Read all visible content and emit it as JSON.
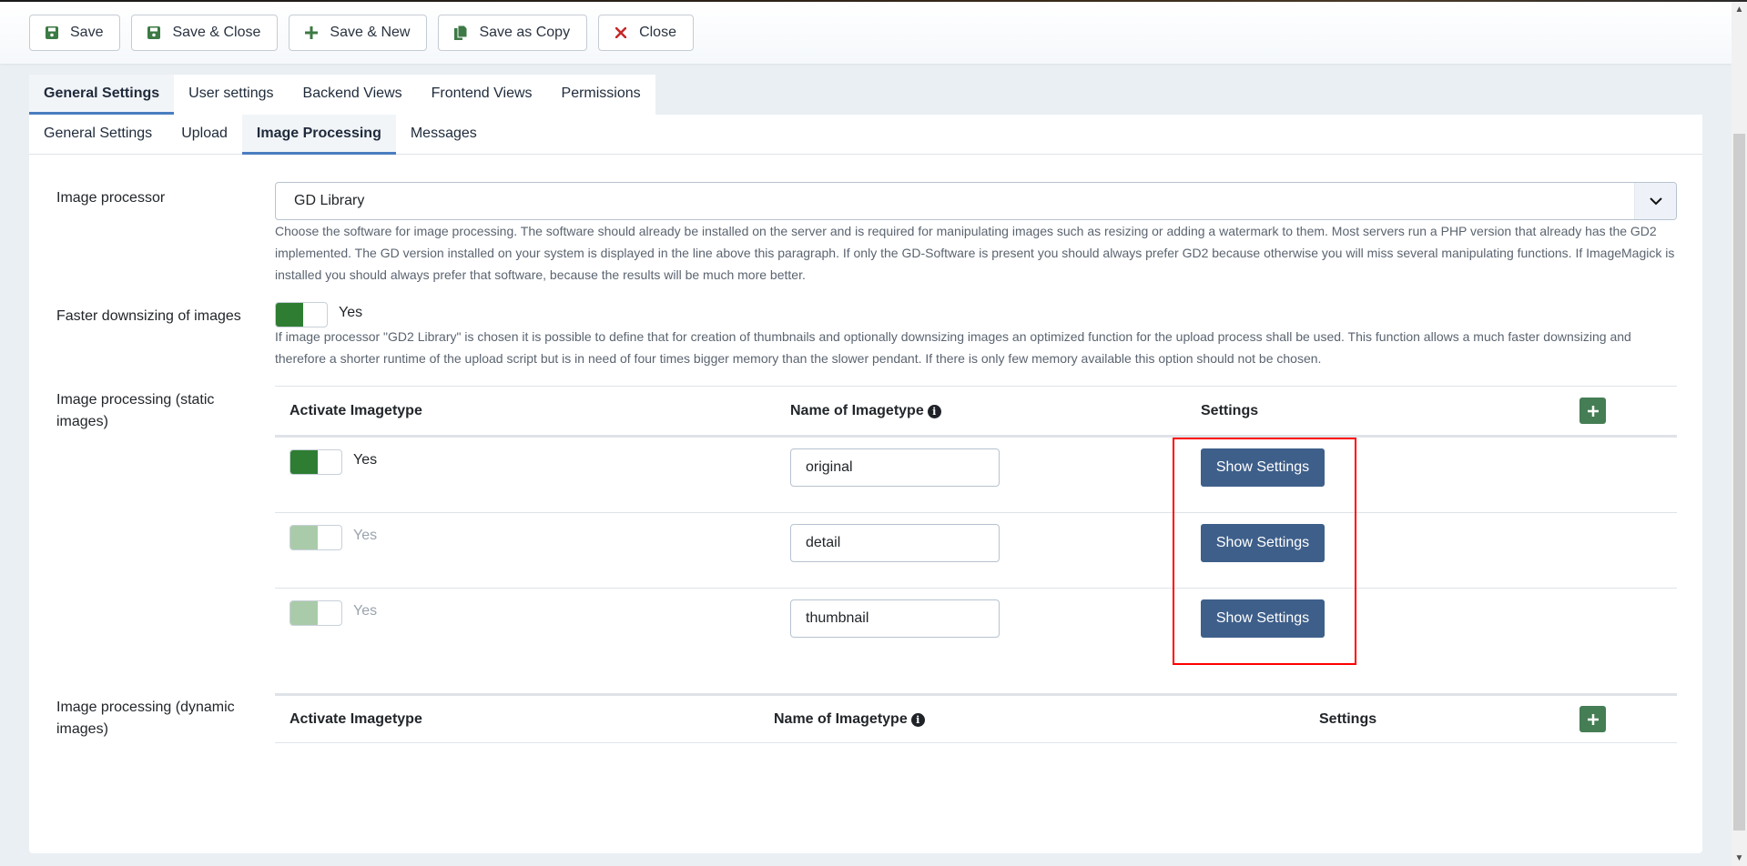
{
  "toolbar": {
    "buttons": [
      {
        "label": "Save",
        "icon": "save-icon"
      },
      {
        "label": "Save & Close",
        "icon": "save-icon"
      },
      {
        "label": "Save & New",
        "icon": "plus-icon"
      },
      {
        "label": "Save as Copy",
        "icon": "copy-icon"
      },
      {
        "label": "Close",
        "icon": "close-icon"
      }
    ]
  },
  "main_tabs": [
    {
      "label": "General Settings",
      "active": true
    },
    {
      "label": "User settings",
      "active": false
    },
    {
      "label": "Backend Views",
      "active": false
    },
    {
      "label": "Frontend Views",
      "active": false
    },
    {
      "label": "Permissions",
      "active": false
    }
  ],
  "sub_tabs": [
    {
      "label": "General Settings",
      "active": false
    },
    {
      "label": "Upload",
      "active": false
    },
    {
      "label": "Image Processing",
      "active": true
    },
    {
      "label": "Messages",
      "active": false
    }
  ],
  "fields": {
    "image_processor": {
      "label": "Image processor",
      "value": "GD Library",
      "description": "Choose the software for image processing. The software should already be installed on the server and is required for manipulating images such as resizing or adding a watermark to them. Most servers run a PHP version that already has the GD2 implemented. The GD version installed on your system is displayed in the line above this paragraph. If only the GD-Software is present you should always prefer GD2 because otherwise you will miss several manipulating functions. If ImageMagick is installed you should always prefer that software, because the results will be much more better."
    },
    "faster_downsizing": {
      "label": "Faster downsizing of images",
      "value": "Yes",
      "enabled": true,
      "description": "If image processor \"GD2 Library\" is chosen it is possible to define that for creation of thumbnails and optionally downsizing images an optimized function for the upload process shall be used. This function allows a much faster downsizing and therefore a shorter runtime of the upload script but is in need of four times bigger memory than the slower pendant. If there is only few memory available this option should not be chosen."
    },
    "static_images": {
      "label": "Image processing (static images)",
      "headers": {
        "activate": "Activate Imagetype",
        "name": "Name of Imagetype",
        "settings": "Settings"
      },
      "rows": [
        {
          "active_label": "Yes",
          "enabled": true,
          "disabled_look": false,
          "name": "original",
          "button": "Show Settings"
        },
        {
          "active_label": "Yes",
          "enabled": true,
          "disabled_look": true,
          "name": "detail",
          "button": "Show Settings"
        },
        {
          "active_label": "Yes",
          "enabled": true,
          "disabled_look": true,
          "name": "thumbnail",
          "button": "Show Settings"
        }
      ]
    },
    "dynamic_images": {
      "label": "Image processing (dynamic images)",
      "headers": {
        "activate": "Activate Imagetype",
        "name": "Name of Imagetype",
        "settings": "Settings"
      }
    }
  },
  "colors": {
    "accent": "#4a7dc0",
    "switch_on": "#2e7d32",
    "switch_disabled": "#a9cba9",
    "primary_button": "#3e5f8a",
    "add_button": "#457d54",
    "highlight": "#ff0000"
  }
}
